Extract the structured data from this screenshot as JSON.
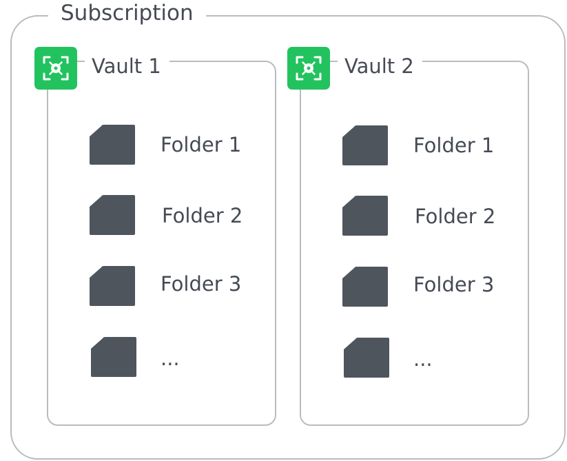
{
  "subscription": {
    "title": "Subscription"
  },
  "colors": {
    "vault_badge": "#22c35e",
    "folder": "#4f555d",
    "border": "#b9bbbf",
    "text": "#454a54"
  },
  "vaults": [
    {
      "title": "Vault 1",
      "icon": "vault-icon",
      "folders": [
        {
          "label": "Folder 1",
          "icon": "folder-icon"
        },
        {
          "label": "Folder 2",
          "icon": "folder-icon"
        },
        {
          "label": "Folder 3",
          "icon": "folder-icon"
        },
        {
          "label": "...",
          "icon": "folder-icon"
        }
      ]
    },
    {
      "title": "Vault 2",
      "icon": "vault-icon",
      "folders": [
        {
          "label": "Folder 1",
          "icon": "folder-icon"
        },
        {
          "label": "Folder 2",
          "icon": "folder-icon"
        },
        {
          "label": "Folder 3",
          "icon": "folder-icon"
        },
        {
          "label": "...",
          "icon": "folder-icon"
        }
      ]
    }
  ]
}
